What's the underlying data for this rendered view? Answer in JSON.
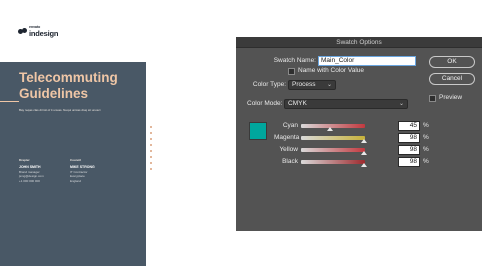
{
  "document": {
    "logo_small": "envato",
    "logo_text": "indesign",
    "title_lines": [
      "Telecommuting",
      "Guidelines"
    ],
    "tagline": "Bay reqas clas dirmit of it unuas. Nequi unicas diuq sit unusci",
    "col1": {
      "label": "Drapter",
      "name": "JOHN SMITH",
      "lines": [
        "Brand manager",
        "jsmg@design.com",
        "+1 000 000 000"
      ]
    },
    "col2": {
      "label": "Council",
      "name": "MIKE STRONG",
      "lines": [
        "IT Contractor",
        "Everyplace",
        "England"
      ]
    }
  },
  "dialog": {
    "title": "Swatch Options",
    "swatch_name_label": "Swatch Name:",
    "swatch_name_value": "Main_Color",
    "name_with_color_value_label": "Name with Color Value",
    "color_type_label": "Color Type:",
    "color_type_value": "Process",
    "color_mode_label": "Color Mode:",
    "color_mode_value": "CMYK",
    "buttons": {
      "ok": "OK",
      "cancel": "Cancel"
    },
    "preview_label": "Preview",
    "swatch_color": "#00a79d",
    "channels": [
      {
        "name": "Cyan",
        "value": "45",
        "unit": "%",
        "fraction": 0.45,
        "color": "#c2393f"
      },
      {
        "name": "Magenta",
        "value": "98",
        "unit": "%",
        "fraction": 0.98,
        "color": "#c7b23a"
      },
      {
        "name": "Yellow",
        "value": "98",
        "unit": "%",
        "fraction": 0.98,
        "color": "#c2393f"
      },
      {
        "name": "Black",
        "value": "98",
        "unit": "%",
        "fraction": 0.98,
        "color": "#9e2a2e"
      }
    ]
  }
}
